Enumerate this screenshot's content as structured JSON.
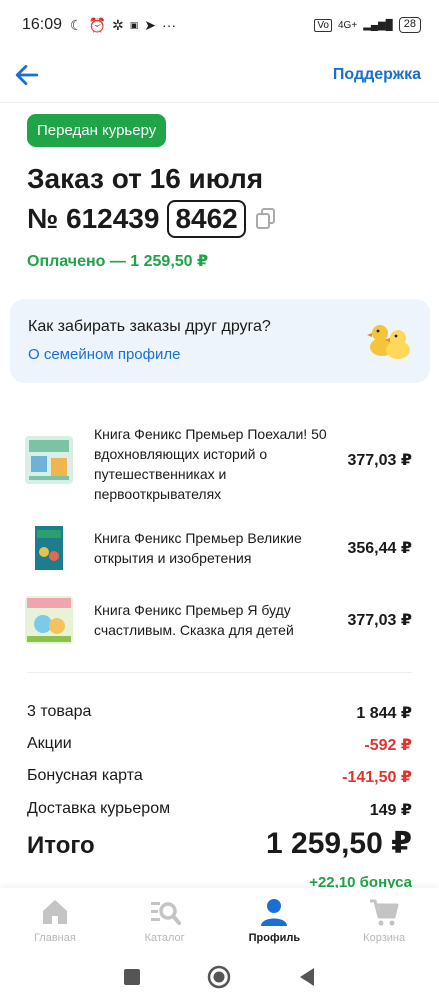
{
  "status_bar": {
    "time": "16:09",
    "network": "4G+",
    "battery": "28"
  },
  "header": {
    "support_label": "Поддержка"
  },
  "order": {
    "status": "Передан курьеру",
    "title": "Заказ от 16 июля",
    "number_prefix": "№ 612439",
    "code": "8462",
    "paid": "Оплачено — 1 259,50 ₽"
  },
  "family": {
    "question": "Как забирать заказы друг друга?",
    "link": "О семейном профиле"
  },
  "items": [
    {
      "name": "Книга Феникс Премьер Поехали! 50 вдохновляющих историй о путешественниках и первооткрывателях",
      "price": "377,03 ₽"
    },
    {
      "name": "Книга Феникс Премьер Великие открытия и изобретения",
      "price": "356,44 ₽"
    },
    {
      "name": "Книга Феникс Премьер Я буду счастливым. Сказка для детей",
      "price": "377,03 ₽"
    }
  ],
  "summary": {
    "goods_label": "3 товара",
    "goods_value": "1 844 ₽",
    "promo_label": "Акции",
    "promo_value": "-592 ₽",
    "bonus_card_label": "Бонусная карта",
    "bonus_card_value": "-141,50 ₽",
    "delivery_label": "Доставка курьером",
    "delivery_value": "149 ₽",
    "total_label": "Итого",
    "total_value": "1 259,50 ₽",
    "bonus_earned": "+22,10 бонуса"
  },
  "bottom_nav": {
    "home": "Главная",
    "catalog": "Каталог",
    "profile": "Профиль",
    "cart": "Корзина"
  },
  "colors": {
    "accent_blue": "#1a6fd4",
    "green": "#1fa447",
    "red": "#e0342d"
  }
}
